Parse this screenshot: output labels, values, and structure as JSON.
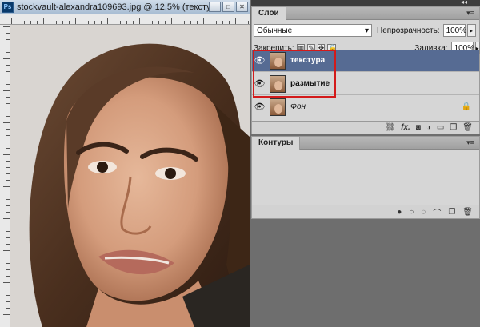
{
  "document": {
    "app_badge": "Ps",
    "title": "stockvault-alexandra109693.jpg @ 12,5% (текстур...",
    "minimize_glyph": "_",
    "restore_glyph": "□",
    "close_glyph": "✕"
  },
  "layers_panel": {
    "tab_label": "Слои",
    "blend_mode": "Обычные",
    "opacity_label": "Непрозрачность:",
    "opacity_value": "100%",
    "lock_label": "Закрепить:",
    "fill_label": "Заливка:",
    "fill_value": "100%",
    "layers": [
      {
        "name": "текстура",
        "selected": true
      },
      {
        "name": "размытие",
        "selected": false
      },
      {
        "name": "Фон",
        "selected": false
      }
    ],
    "footer_icons": [
      "link-icon",
      "fx-icon",
      "mask-icon",
      "adjustment-icon",
      "group-icon",
      "new-layer-icon",
      "trash-icon"
    ],
    "footer_fx": "fx."
  },
  "paths_panel": {
    "tab_label": "Контуры",
    "footer_icons": [
      "fill-path-icon",
      "stroke-path-icon",
      "selection-icon",
      "work-path-icon",
      "new-path-icon",
      "trash-icon"
    ]
  },
  "colors": {
    "selection": "#566b93",
    "highlight": "#d31a1a",
    "workspace": "#6e6e6e"
  }
}
